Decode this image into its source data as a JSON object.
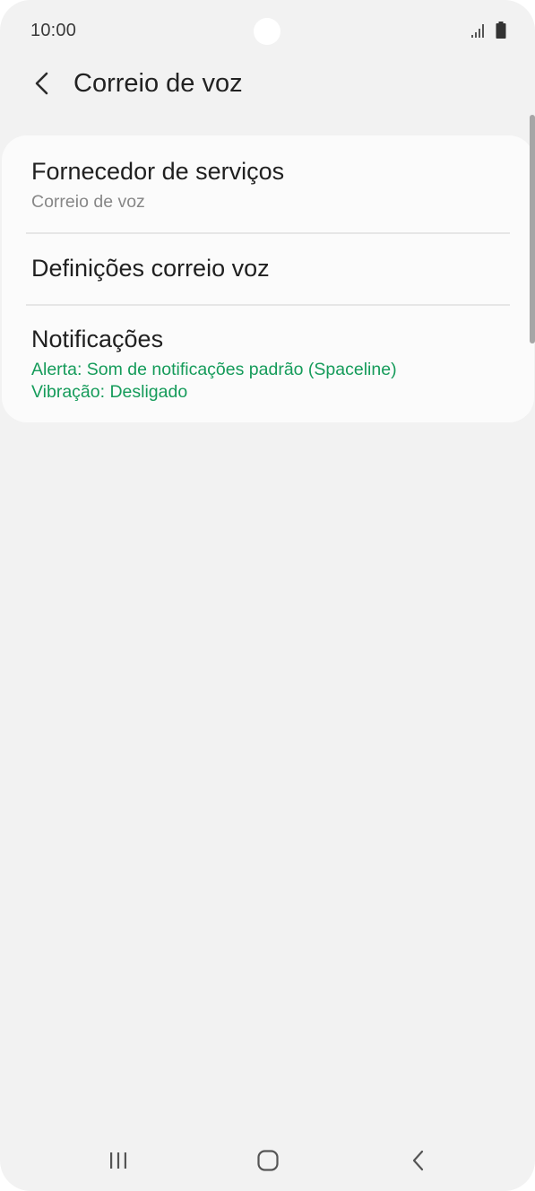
{
  "status_bar": {
    "time": "10:00",
    "icons": [
      "signal-icon",
      "battery-icon"
    ]
  },
  "header": {
    "back_icon": "chevron-left-icon",
    "title": "Correio de voz"
  },
  "settings": {
    "items": [
      {
        "title": "Fornecedor de serviços",
        "subtitle": "Correio de voz"
      },
      {
        "title": "Definições correio voz"
      },
      {
        "title": "Notificações",
        "subtitle_line1": "Alerta: Som de notificações padrão (Spaceline)",
        "subtitle_line2": "Vibração: Desligado"
      }
    ]
  },
  "nav_bar": {
    "icons": [
      "recent-apps-icon",
      "home-icon",
      "back-icon"
    ]
  },
  "colors": {
    "background": "#f2f2f2",
    "card": "#fbfbfb",
    "accent_green": "#159b5a",
    "secondary_text": "#878787",
    "primary_text": "#202020"
  }
}
